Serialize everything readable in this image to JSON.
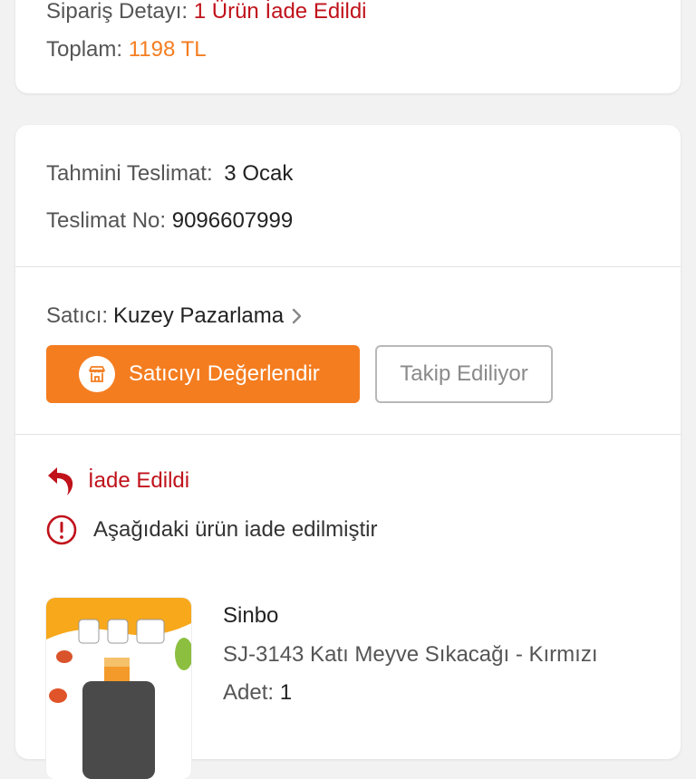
{
  "order_summary": {
    "detail_label": "Sipariş Detayı:",
    "detail_value": "1 Ürün İade Edildi",
    "total_label": "Toplam:",
    "total_value": "1198 TL"
  },
  "delivery": {
    "estimated_label": "Tahmini Teslimat:",
    "estimated_value": "3 Ocak",
    "number_label": "Teslimat No:",
    "number_value": "9096607999"
  },
  "seller": {
    "label": "Satıcı:",
    "name": "Kuzey Pazarlama",
    "rate_button": "Satıcıyı Değerlendir",
    "follow_button": "Takip Ediliyor"
  },
  "return_status": {
    "title": "İade Edildi",
    "info": "Aşağıdaki ürün iade edilmiştir"
  },
  "product": {
    "brand": "Sinbo",
    "name": "SJ-3143 Katı Meyve Sıkacağı - Kırmızı",
    "qty_label": "Adet:",
    "qty_value": "1"
  },
  "colors": {
    "accent": "#f47d20",
    "danger": "#c0121b",
    "background": "#f2f2f2"
  }
}
